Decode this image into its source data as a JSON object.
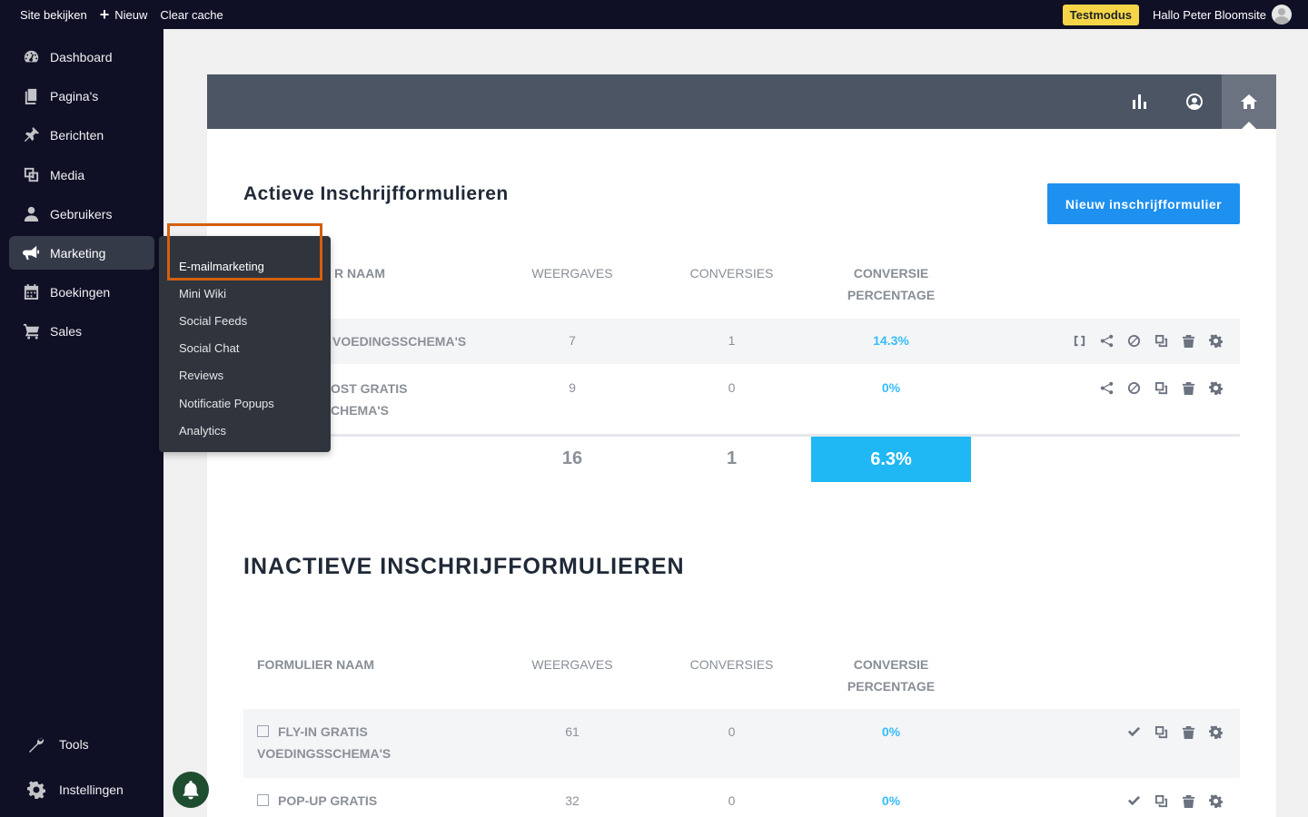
{
  "topbar": {
    "view_site": "Site bekijken",
    "new": "Nieuw",
    "clear_cache": "Clear cache",
    "test_mode": "Testmodus",
    "greeting": "Hallo Peter Bloomsite"
  },
  "sidebar": {
    "items": [
      {
        "label": "Dashboard",
        "icon": "dashboard-icon"
      },
      {
        "label": "Pagina's",
        "icon": "pages-icon"
      },
      {
        "label": "Berichten",
        "icon": "pin-icon"
      },
      {
        "label": "Media",
        "icon": "media-icon"
      },
      {
        "label": "Gebruikers",
        "icon": "user-icon"
      },
      {
        "label": "Marketing",
        "icon": "megaphone-icon"
      },
      {
        "label": "Boekingen",
        "icon": "calendar-icon"
      },
      {
        "label": "Sales",
        "icon": "cart-icon"
      }
    ],
    "tools": "Tools",
    "settings": "Instellingen"
  },
  "flyout": {
    "items": [
      "E-mailmarketing",
      "Mini Wiki",
      "Social Feeds",
      "Social Chat",
      "Reviews",
      "Notificatie Popups",
      "Analytics"
    ]
  },
  "main": {
    "active_title": "Actieve Inschrijfformulieren",
    "new_button": "Nieuw inschrijfformulier",
    "inactive_title": "INACTIEVE INSCHRIJFFORMULIEREN",
    "headers": {
      "name": "FORMULIER NAAM",
      "name_partial": "R NAAM",
      "views": "WEERGAVES",
      "conversions": "CONVERSIES",
      "pct_line1": "CONVERSIE",
      "pct_line2": "PERCENTAGE"
    },
    "active_rows": [
      {
        "name_line1": "VOEDINGSSCHEMA'S",
        "name_line2": "",
        "views": "7",
        "conversions": "1",
        "pct": "14.3%"
      },
      {
        "name_line1": "OST GRATIS",
        "name_line2": "CHEMA'S",
        "views": "9",
        "conversions": "0",
        "pct": "0%"
      }
    ],
    "totals": {
      "views": "16",
      "conversions": "1",
      "pct": "6.3%"
    },
    "inactive_rows": [
      {
        "name_line1": "FLY-IN GRATIS",
        "name_line2": "VOEDINGSSCHEMA'S",
        "views": "61",
        "conversions": "0",
        "pct": "0%"
      },
      {
        "name_line1": "POP-UP GRATIS",
        "name_line2": "",
        "views": "32",
        "conversions": "0",
        "pct": "0%"
      }
    ]
  }
}
